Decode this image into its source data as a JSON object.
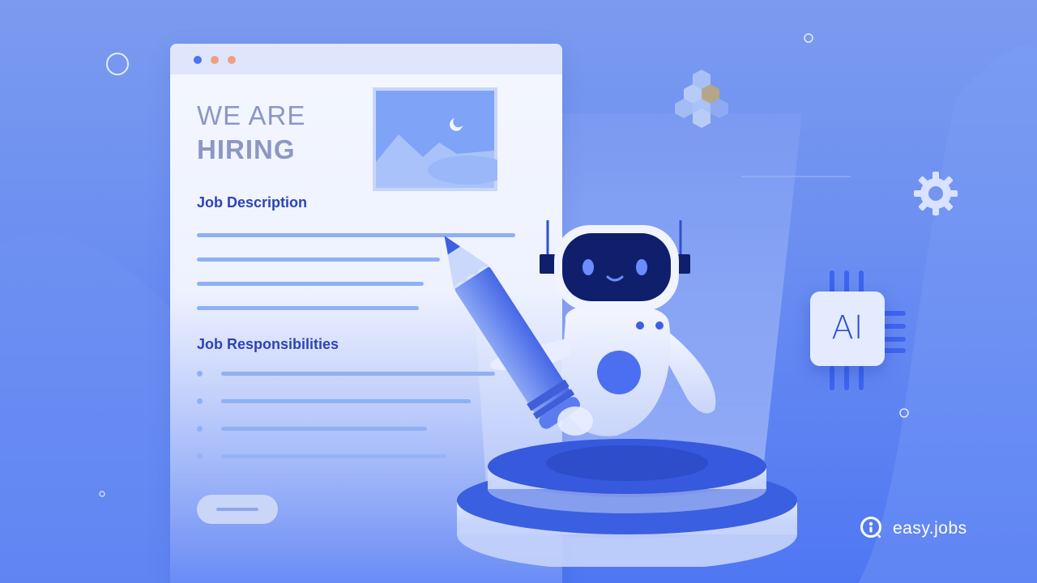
{
  "document": {
    "heading_line1": "WE ARE",
    "heading_line2": "HIRING",
    "section_description": "Job Description",
    "section_responsibilities": "Job Responsibilities"
  },
  "chip": {
    "label": "AI"
  },
  "brand": {
    "name": "easy.jobs"
  },
  "colors": {
    "accent": "#2d44b4",
    "robot_face": "#0f1f6b",
    "robot_eye": "#6b8dff",
    "chip_blue": "#2e4bd6",
    "background": "#6c8ff1"
  },
  "icons": [
    "window-dots-icon",
    "landscape-image-icon",
    "pencil-icon",
    "robot-icon",
    "gear-icon",
    "hexagon-cluster-icon",
    "ai-chip-icon",
    "easyjobs-logo-icon",
    "pedestal-icon"
  ]
}
